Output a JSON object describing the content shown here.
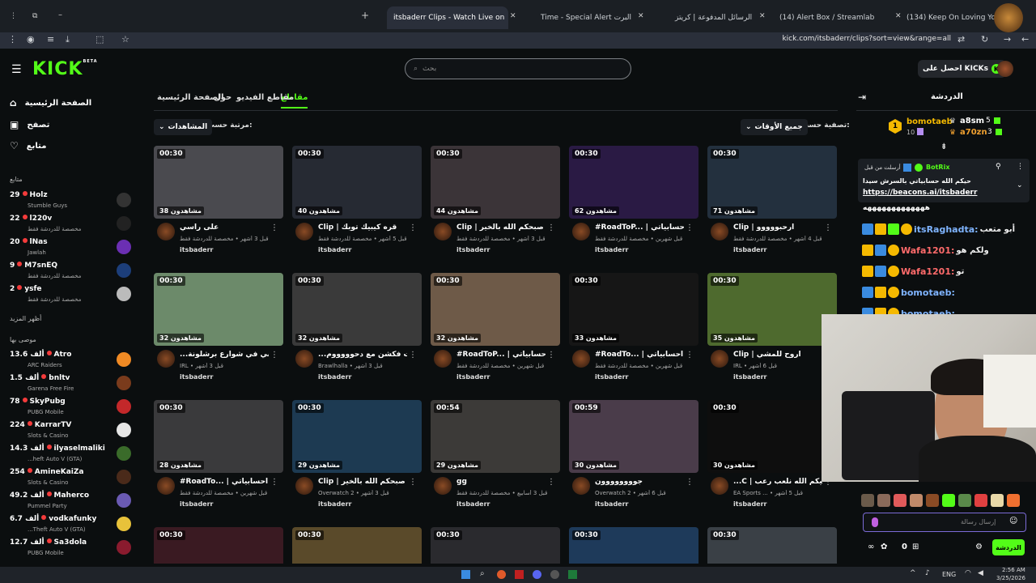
{
  "browser": {
    "tabs": [
      {
        "title": "itsbaderr Clips - Watch Live on",
        "active": true
      },
      {
        "title": "Time - Special Alert البرت"
      },
      {
        "title": "الرسائل المدفوعة | كريتز"
      },
      {
        "title": "(14) Alert Box / Streamlabs"
      },
      {
        "title": "(134) Keep On Loving You - Cig"
      }
    ],
    "url": "kick.com/itsbaderr/clips?sort=view&range=all"
  },
  "header": {
    "logo": "KICK",
    "logo_sup": "BETA",
    "search_placeholder": "بحث",
    "get_kicks": "احصل على KICKs"
  },
  "sidebar": {
    "nav": [
      {
        "label": "الصفحة الرئيسية",
        "icon": "home-icon"
      },
      {
        "label": "تصفح",
        "icon": "browse-icon"
      },
      {
        "label": "متابع",
        "icon": "heart-icon"
      }
    ],
    "following_title": "متابع",
    "following": [
      {
        "count": "29",
        "name": "Holz",
        "sub": "Stumble Guys",
        "color": "#333"
      },
      {
        "count": "22",
        "name": "l220v",
        "sub": "مخصصة للدردشة فقط",
        "color": "#222"
      },
      {
        "count": "20",
        "name": "lNas",
        "sub": "Jawlah",
        "color": "#6b2fb3"
      },
      {
        "count": "9",
        "name": "M7snEQ",
        "sub": "مخصصة للدردشة فقط",
        "color": "#1c3e7a"
      },
      {
        "count": "2",
        "name": "ysfe",
        "sub": "مخصصة للدردشة فقط",
        "color": "#bbb"
      }
    ],
    "show_more": "أظهر المزيد",
    "recommended_title": "موصى بها",
    "recommended": [
      {
        "count": "13.6 ألف",
        "name": "Atro",
        "sub": "ARC Raiders",
        "color": "#f08a24"
      },
      {
        "count": "1.5 ألف",
        "name": "bnltv",
        "sub": "Garena Free Fire",
        "color": "#7a3b1c"
      },
      {
        "count": "78",
        "name": "SkyPubg",
        "sub": "PUBG Mobile",
        "color": "#c3282a"
      },
      {
        "count": "224",
        "name": "KarrarTV",
        "sub": "Slots & Casino",
        "color": "#e6e6e6"
      },
      {
        "count": "14.3 ألف",
        "name": "ilyaselmaliki",
        "sub": "...heft Auto V (GTA)",
        "color": "#3a6b2a"
      },
      {
        "count": "254",
        "name": "AmineKaiZa",
        "sub": "Slots & Casino",
        "color": "#4a2a1a"
      },
      {
        "count": "49.2 ألف",
        "name": "Maherco",
        "sub": "Pummel Party",
        "color": "#6a5ab3"
      },
      {
        "count": "6.7 ألف",
        "name": "vodkafunky",
        "sub": "...Theft Auto V (GTA)",
        "color": "#e8c23a"
      },
      {
        "count": "12.7 ألف",
        "name": "Sa3dola",
        "sub": "PUBG Mobile",
        "color": "#8a1b2e"
      }
    ]
  },
  "content": {
    "tabs": [
      "مقاطع",
      "مقاطع الفيديو",
      "حول",
      "الصفحة الرئيسية"
    ],
    "filter_label": "تصفية حسب:",
    "filter_value": "جميع الأوقات",
    "sort_label": "مرتبة حسب:",
    "sort_value": "المشاهدات",
    "clips": [
      {
        "dur": "00:30",
        "views": "مشاهدون 71",
        "title": "Clip | ارحبووووو",
        "meta": "قبل 4 أشهر • مخصصة للدردشة فقط",
        "channel": "itsbaderr",
        "bg": "#23303e"
      },
      {
        "dur": "00:30",
        "views": "مشاهدون 62",
        "title": "#RoadToP... | احسابياتي",
        "meta": "قبل شهرين • مخصصة للدردشة فقط",
        "channel": "itsbaderr",
        "bg": "#2a1a44"
      },
      {
        "dur": "00:30",
        "views": "مشاهدون 44",
        "title": "Clip | صبحكم الله بالخير",
        "meta": "قبل 3 أشهر • مخصصة للدردشة فقط",
        "channel": "itsbaderr",
        "bg": "#3b3438"
      },
      {
        "dur": "00:30",
        "views": "مشاهدون 40",
        "title": "Clip | قره كيبيك توبك",
        "meta": "قبل 5 أشهر • مخصصة للدردشة فقط",
        "channel": "itsbaderr",
        "bg": "#262a33"
      },
      {
        "dur": "00:30",
        "views": "مشاهدون 38",
        "title": "على راسي",
        "meta": "قبل 3 أشهر • مخصصة للدردشة فقط",
        "channel": "itsbaderr",
        "bg": "#4a4a4f"
      },
      {
        "dur": "00:30",
        "views": "مشاهدون 35",
        "title": "Clip | اروح للمشي",
        "meta": "IRL • قبل 6 أشهر",
        "channel": "itsbaderr",
        "bg": "#4e6a2e"
      },
      {
        "dur": "00:30",
        "views": "مشاهدون 33",
        "title": "#RoadTo... | احسابياتي",
        "meta": "قبل شهرين • مخصصة للدردشة فقط",
        "channel": "itsbaderr",
        "bg": "#161616"
      },
      {
        "dur": "00:30",
        "views": "مشاهدون 32",
        "title": "#RoadToP... | احسابياتي",
        "meta": "قبل شهرين • مخصصة للدردشة فقط",
        "channel": "itsbaderr",
        "bg": "#6e5a48"
      },
      {
        "dur": "00:30",
        "views": "مشاهدون 32",
        "title": "...سبلت فكشن مع دحوووووم",
        "meta": "Brawlhalla • قبل 3 أشهر",
        "channel": "itsbaderr",
        "bg": "#3a3a3a"
      },
      {
        "dur": "00:30",
        "views": "مشاهدون 32",
        "title": "...مشي في شوارع برشلونة",
        "meta": "IRL • قبل 3 أشهر",
        "channel": "itsbaderr",
        "bg": "#6c8a6a"
      },
      {
        "dur": "00:30",
        "views": "مشاهدون 30",
        "title": "...C | حيكم الله نلعب رعب",
        "meta": "EA Sports ... • قبل 5 أشهر",
        "channel": "itsbaderr",
        "bg": "#0e0e0e"
      },
      {
        "dur": "00:59",
        "views": "مشاهدون 30",
        "title": "جوووووووون",
        "meta": "Overwatch 2 • قبل 6 أشهر",
        "channel": "itsbaderr",
        "bg": "#4a3c4a"
      },
      {
        "dur": "00:54",
        "views": "مشاهدون 29",
        "title": "gg",
        "meta": "قبل 3 أسابيع • مخصصة للدردشة فقط",
        "channel": "itsbaderr",
        "bg": "#3c3a38"
      },
      {
        "dur": "00:30",
        "views": "مشاهدون 29",
        "title": "Clip | صبحكم الله بالخير",
        "meta": "Overwatch 2 • قبل 3 أشهر",
        "channel": "itsbaderr",
        "bg": "#1d3a52"
      },
      {
        "dur": "00:30",
        "views": "مشاهدون 28",
        "title": "#RoadTo... | احسابياتي",
        "meta": "قبل شهرين • مخصصة للدردشة فقط",
        "channel": "itsbaderr",
        "bg": "#3a3a3c"
      },
      {
        "dur": "00:30",
        "views": "",
        "title": "",
        "meta": "",
        "channel": "",
        "bg": "#3a4046"
      },
      {
        "dur": "00:30",
        "views": "",
        "title": "",
        "meta": "",
        "channel": "",
        "bg": "#1e3a5a"
      },
      {
        "dur": "00:30",
        "views": "",
        "title": "",
        "meta": "",
        "channel": "",
        "bg": "#2a2a2e"
      },
      {
        "dur": "00:30",
        "views": "",
        "title": "",
        "meta": "",
        "channel": "",
        "bg": "#5a4a2a"
      },
      {
        "dur": "00:30",
        "views": "",
        "title": "",
        "meta": "",
        "channel": "",
        "bg": "#3a1a22"
      }
    ]
  },
  "chat": {
    "title": "الدردشة",
    "gifter_top": {
      "name": "bomotaeb",
      "count": "10",
      "rank": "1"
    },
    "gifters": [
      {
        "name": "a8sm",
        "count": "5"
      },
      {
        "name": "a70zn",
        "count": "3"
      }
    ],
    "pinned_user": "BotRix",
    "pinned_meta": "أرسلت من قبل",
    "pinned_text": "حيكم الله حسابياتي بالسرش سيدا",
    "pinned_link": "https://beacons.ai/itsbaderr",
    "partial_line": "هههههههههههههه",
    "messages": [
      {
        "user": "itsRaghadta:",
        "text": "أبو متعب",
        "color": "#7fb4ff"
      },
      {
        "user": "Wafa1201:",
        "text": "ولكم هو",
        "color": "#ff6b6b"
      },
      {
        "user": "Wafa1201:",
        "text": "تو",
        "color": "#ff6b6b"
      },
      {
        "user": "bomotaeb:",
        "text": "",
        "color": "#7fb4ff"
      },
      {
        "user": "bomotaeb:",
        "text": "",
        "color": "#7fb4ff"
      }
    ],
    "input_placeholder": "إرسال رسالة",
    "chat_button": "الدردشة",
    "points": "0"
  },
  "taskbar": {
    "time": "2:56 AM",
    "date": "3/25/2026",
    "lang": "ENG"
  },
  "colors": {
    "accent": "#53fc18",
    "bg": "#0b0e0f"
  }
}
